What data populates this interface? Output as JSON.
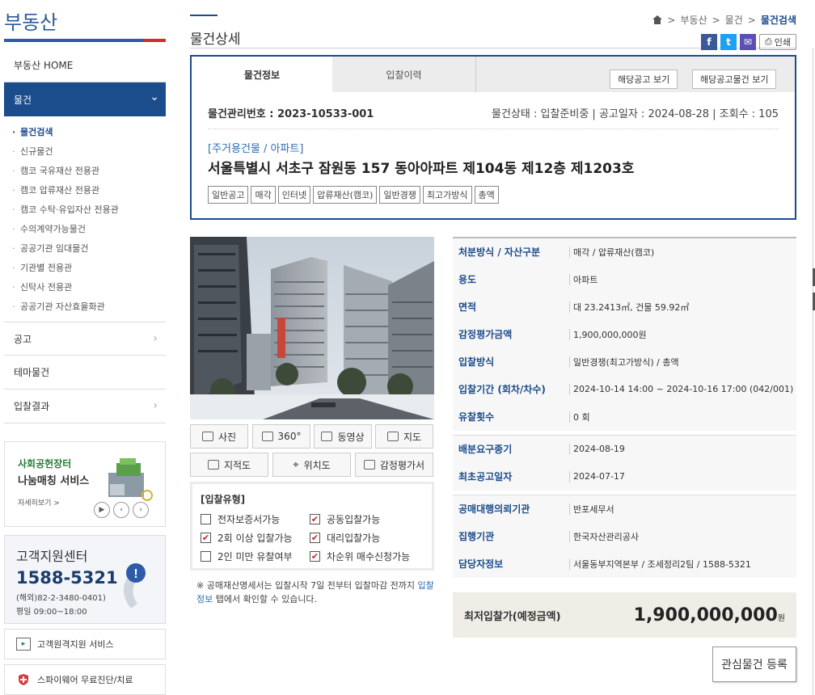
{
  "sidebar": {
    "brand": "부동산",
    "home": "부동산 HOME",
    "active_section": "물건",
    "sub_items": [
      "물건검색",
      "신규물건",
      "캠코 국유재산 전용관",
      "캠코 압류재산 전용관",
      "캠코 수탁·유입자산 전용관",
      "수의계약가능물건",
      "공공기관 임대물건",
      "기관별 전용관",
      "신탁사 전용관",
      "공공기관 자산효율화관"
    ],
    "other_items": [
      "공고",
      "테마물건",
      "입찰결과"
    ],
    "banner": {
      "line1": "사회공헌장터",
      "line2": "나눔매칭 서비스",
      "more": "자세히보기 >"
    },
    "customer": {
      "title": "고객지원센터",
      "phone": "1588-5321",
      "overseas": "(해외)82-2-3480-0401)",
      "hours": "평일 09:00~18:00"
    },
    "services": [
      "고객원격지원 서비스",
      "스파이웨어 무료진단/치료"
    ]
  },
  "header": {
    "title": "물건상세",
    "breadcrumb": [
      "부동산",
      "물건",
      "물건검색"
    ],
    "print_label": "인쇄"
  },
  "tabs": {
    "info": "물건정보",
    "history": "입찰이력",
    "btn_notice": "해당공고 보기",
    "btn_notice_items": "해당공고물건 보기"
  },
  "item": {
    "id_label": "물건관리번호 : 2023-10533-001",
    "status": "물건상태 : 입찰준비중",
    "notice_date": "공고일자 : 2024-08-28",
    "views": "조회수 : 105",
    "category": "[주거용건물 / 아파트]",
    "address": "서울특별시 서초구 잠원동 157 동아아파트 제104동 제12층 제1203호",
    "tags": [
      "일반공고",
      "매각",
      "인터넷",
      "압류재산(캠코)",
      "일반경쟁",
      "최고가방식",
      "총액"
    ]
  },
  "media_buttons": [
    "사진",
    "360°",
    "동영상",
    "지도",
    "지적도",
    "위치도",
    "감정평가서"
  ],
  "bid_type": {
    "title": "[입찰유형]",
    "options": [
      {
        "label": "전자보증서가능",
        "checked": false
      },
      {
        "label": "공동입찰가능",
        "checked": true
      },
      {
        "label": "2회 이상 입찰가능",
        "checked": true
      },
      {
        "label": "대리입찰가능",
        "checked": true
      },
      {
        "label": "2인 미만 유찰여부",
        "checked": false
      },
      {
        "label": "차순위 매수신청가능",
        "checked": true
      }
    ],
    "note_pre": "※ 공매재산명세서는 입찰시작 7일 전부터 입찰마감 전까지 ",
    "note_link": "입찰정보",
    "note_post": " 탭에서 확인할 수 있습니다."
  },
  "info_rows": [
    {
      "k": "처분방식 / 자산구분",
      "v": "매각 / 압류재산(캠코)"
    },
    {
      "k": "용도",
      "v": "아파트"
    },
    {
      "k": "면적",
      "v": "대 23.2413㎡, 건물 59.92㎡"
    },
    {
      "k": "감정평가금액",
      "v": "1,900,000,000원"
    },
    {
      "k": "입찰방식",
      "v": "일반경쟁(최고가방식) / 총액"
    },
    {
      "k": "입찰기간 (회차/차수)",
      "v": "2024-10-14 14:00 ~ 2024-10-16 17:00 (042/001)"
    },
    {
      "k": "유찰횟수",
      "v": "0 회"
    },
    {
      "k": "배분요구종기",
      "v": "2024-08-19"
    },
    {
      "k": "최초공고일자",
      "v": "2024-07-17"
    },
    {
      "k": "공매대행의뢰기관",
      "v": "반포세무서"
    },
    {
      "k": "집행기관",
      "v": "한국자산관리공사"
    },
    {
      "k": "담당자정보",
      "v": "서울동부지역본부 / 조세정리2팀 / 1588-5321"
    }
  ],
  "min_bid": {
    "label": "최저입찰가(예정금액)",
    "value": "1,900,000,000",
    "unit": "원"
  },
  "fav_button": "관심물건 등록",
  "colors": {
    "primary": "#1b4c8c",
    "accent": "#d12b2b",
    "link": "#2f6db5"
  }
}
